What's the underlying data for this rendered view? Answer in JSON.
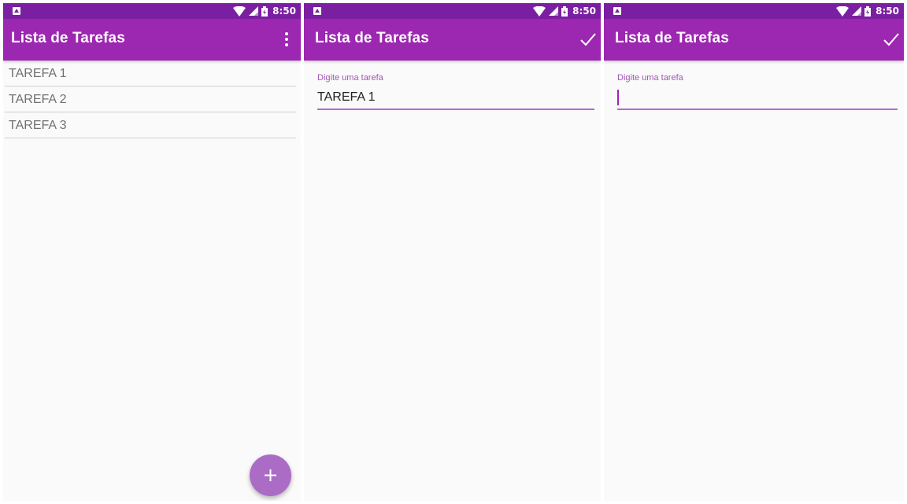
{
  "status_bar": {
    "time": "8:50"
  },
  "app_bar": {
    "title": "Lista de Tarefas"
  },
  "screens": {
    "list": {
      "tasks": [
        "TAREFA 1",
        "TAREFA 2",
        "TAREFA 3"
      ],
      "fab_icon": "plus-icon",
      "menu_icon": "more-vert-icon"
    },
    "edit": {
      "label": "Digite uma tarefa",
      "value": "TAREFA 1",
      "action_icon": "check-icon"
    },
    "add": {
      "label": "Digite uma tarefa",
      "value": "",
      "action_icon": "check-icon"
    }
  },
  "colors": {
    "status_bar": "#7b1fa2",
    "app_bar": "#9c27b0",
    "fab": "#ab6cc6",
    "accent": "#b36bc8"
  }
}
